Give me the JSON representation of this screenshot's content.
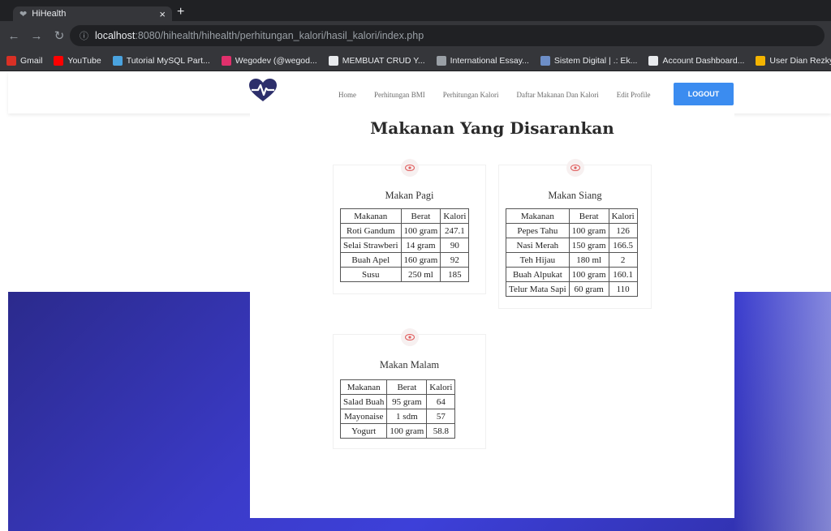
{
  "browser": {
    "tab_title": "HiHealth",
    "tab_close": "×",
    "new_tab": "+",
    "url_host": "localhost",
    "url_rest": ":8080/hihealth/hihealth/perhitungan_kalori/hasil_kalori/index.php",
    "bookmarks": [
      {
        "label": "Gmail",
        "color": "#d93025"
      },
      {
        "label": "YouTube",
        "color": "#ff0000"
      },
      {
        "label": "Tutorial MySQL Part...",
        "color": "#4aa3df"
      },
      {
        "label": "Wegodev (@wegod...",
        "color": "#e1306c"
      },
      {
        "label": "MEMBUAT CRUD Y...",
        "color": "#e8eaed"
      },
      {
        "label": "International Essay...",
        "color": "#9aa0a6"
      },
      {
        "label": "Sistem Digital | .: Ek...",
        "color": "#6d8ec7"
      },
      {
        "label": "Account Dashboard...",
        "color": "#e8eaed"
      },
      {
        "label": "User Dian Rezky W...",
        "color": "#f4b400"
      }
    ]
  },
  "nav": {
    "links": [
      "Home",
      "Perhitungan BMI",
      "Perhitungan Kalori",
      "Daftar Makanan Dan Kalori",
      "Edit Profile"
    ],
    "logout_label": "LOGOUT",
    "accent": "#3b8cf0"
  },
  "main": {
    "heading": "Makanan Yang Disarankan",
    "cards": [
      {
        "title": "Makan Pagi",
        "headers": [
          "Makanan",
          "Berat",
          "Kalori"
        ],
        "rows": [
          [
            "Roti Gandum",
            "100 gram",
            "247.1"
          ],
          [
            "Selai Strawberi",
            "14 gram",
            "90"
          ],
          [
            "Buah Apel",
            "160 gram",
            "92"
          ],
          [
            "Susu",
            "250 ml",
            "185"
          ]
        ]
      },
      {
        "title": "Makan Siang",
        "headers": [
          "Makanan",
          "Berat",
          "Kalori"
        ],
        "rows": [
          [
            "Pepes Tahu",
            "100 gram",
            "126"
          ],
          [
            "Nasi Merah",
            "150 gram",
            "166.5"
          ],
          [
            "Teh Hijau",
            "180 ml",
            "2"
          ],
          [
            "Buah Alpukat",
            "100 gram",
            "160.1"
          ],
          [
            "Telur Mata Sapi",
            "60 gram",
            "110"
          ]
        ]
      },
      {
        "title": "Makan Malam",
        "headers": [
          "Makanan",
          "Berat",
          "Kalori"
        ],
        "rows": [
          [
            "Salad Buah",
            "95 gram",
            "64"
          ],
          [
            "Mayonaise",
            "1 sdm",
            "57"
          ],
          [
            "Yogurt",
            "100 gram",
            "58.8"
          ]
        ]
      }
    ]
  }
}
